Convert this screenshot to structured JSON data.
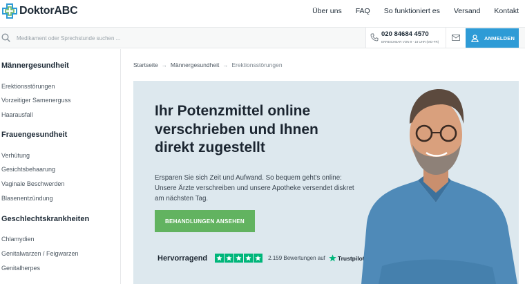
{
  "brand": {
    "name": "DoktorABC"
  },
  "nav": {
    "items": [
      "Über uns",
      "FAQ",
      "So funktioniert es",
      "Versand",
      "Kontakt"
    ]
  },
  "search": {
    "placeholder": "Medikament oder Sprechstunde suchen ..."
  },
  "contact": {
    "phone": "020 84684 4570",
    "hours": "ERREICHBAR VON 9 - 18 UHR (MO-FR)"
  },
  "login": {
    "label": "ANMELDEN"
  },
  "sidebar": {
    "categories": [
      {
        "title": "Männergesundheit",
        "items": [
          "Erektionsstörungen",
          "Vorzeitiger Samenerguss",
          "Haarausfall"
        ]
      },
      {
        "title": "Frauengesundheit",
        "items": [
          "Verhütung",
          "Gesichtsbehaarung",
          "Vaginale Beschwerden",
          "Blasenentzündung"
        ]
      },
      {
        "title": "Geschlechtskrankheiten",
        "items": [
          "Chlamydien",
          "Genitalwarzen / Feigwarzen",
          "Genitalherpes"
        ]
      }
    ]
  },
  "breadcrumb": {
    "items": [
      "Startseite",
      "Männergesundheit",
      "Erektionsstörungen"
    ],
    "separator": "→"
  },
  "hero": {
    "title": "Ihr Potenzmittel online verschrieben und Ihnen direkt zugestellt",
    "text": "Ersparen Sie sich Zeit und Aufwand. So bequem geht's online: Unsere Ärzte verschreiben und unsere Apotheke versendet diskret am nächsten Tag.",
    "cta": "BEHANDLUNGEN ANSEHEN"
  },
  "rating": {
    "label": "Hervorragend",
    "stars": 5,
    "count_text": "2.159 Bewertungen auf",
    "provider": "Trustpilot"
  },
  "colors": {
    "accent_blue": "#2e9bd6",
    "cta_green": "#62b360",
    "trustpilot_green": "#00b67a",
    "hero_bg": "#dde8ee"
  }
}
